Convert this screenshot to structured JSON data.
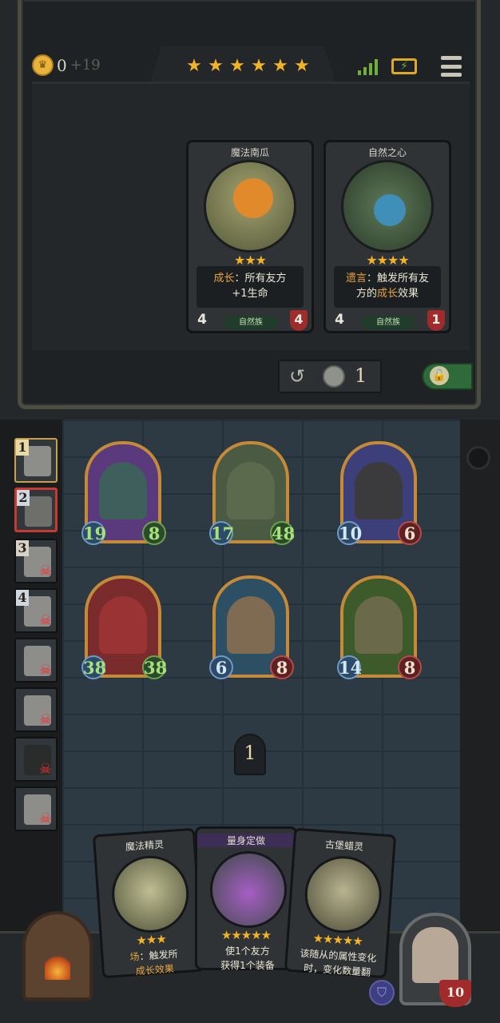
{
  "header": {
    "gold": "0",
    "income": "+19",
    "tavern_stars": [
      "★",
      "★",
      "★",
      "★",
      "★",
      "★"
    ],
    "signal_icon": "signal-bars-icon",
    "battery_icon": "battery-charging-icon",
    "menu_icon": "menu-icon"
  },
  "shop": {
    "cards": [
      {
        "name": "魔法南瓜",
        "stars": "★★★",
        "desc_kw": "成长",
        "desc_rest": "：所有友方",
        "desc_line2": "+1生命",
        "tribe": "自然族",
        "attack": "4",
        "health": "4"
      },
      {
        "name": "自然之心",
        "stars": "★★★★",
        "desc_kw": "遗言",
        "desc_rest": "：触发所有友",
        "desc_line2_pre": "方的",
        "desc_line2_kw": "成长",
        "desc_line2_post": "效果",
        "tribe": "自然族",
        "attack": "4",
        "health": "1"
      }
    ],
    "refresh_cost": "1"
  },
  "opponents": [
    {
      "rank": "1",
      "state": "first"
    },
    {
      "rank": "2",
      "state": "active"
    },
    {
      "rank": "3",
      "state": "dead"
    },
    {
      "rank": "4",
      "state": "dead"
    },
    {
      "rank": "",
      "state": "dead"
    },
    {
      "rank": "",
      "state": "dead"
    },
    {
      "rank": "",
      "state": "dead"
    },
    {
      "rank": "",
      "state": "dead"
    }
  ],
  "board": {
    "units": [
      {
        "attack": "19",
        "health": "8"
      },
      {
        "attack": "17",
        "health": "48"
      },
      {
        "attack": "10",
        "health": "6"
      },
      {
        "attack": "38",
        "health": "38"
      },
      {
        "attack": "6",
        "health": "8"
      },
      {
        "attack": "14",
        "health": "8"
      }
    ],
    "turn": "1"
  },
  "hand": [
    {
      "name": "魔法精灵",
      "stars": "★★★",
      "desc_kw": "场",
      "desc_rest": "：触发所",
      "desc_line2": "成长效果"
    },
    {
      "name": "量身定做",
      "stars": "★★★★★",
      "desc": "使1个友方",
      "desc_line2": "获得1个装备"
    },
    {
      "name": "古堡蜡灵",
      "stars": "★★★★★",
      "desc": "该随从的属性变化",
      "desc_line2": "时，变化数量翻"
    }
  ],
  "hero": {
    "health": "10"
  }
}
